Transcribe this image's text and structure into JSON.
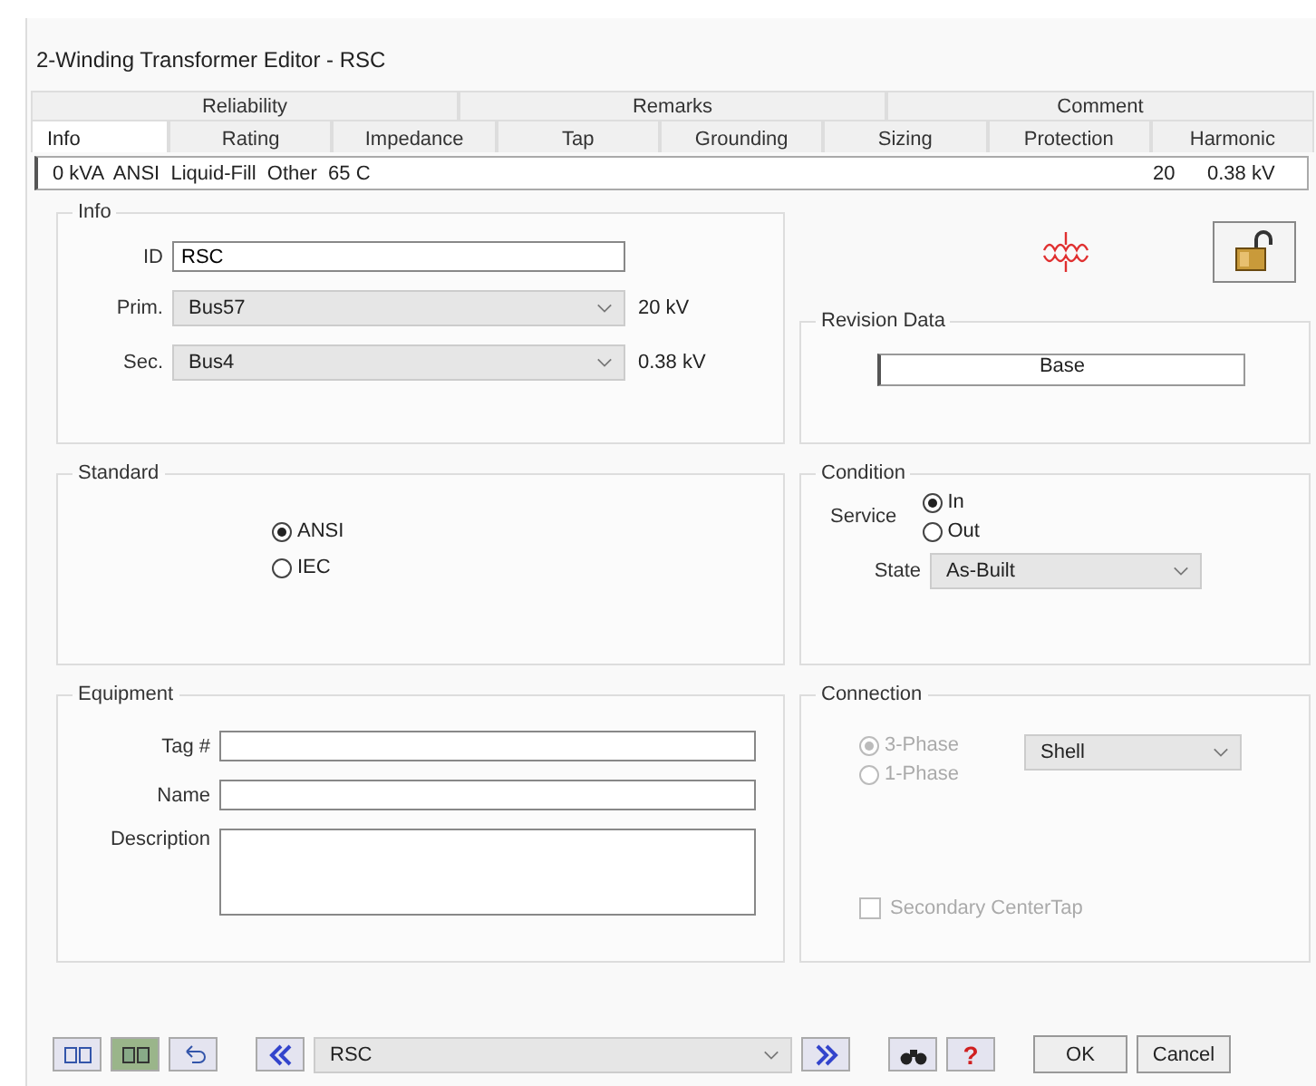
{
  "window": {
    "title": "2-Winding Transformer Editor - RSC"
  },
  "tabs_back": [
    {
      "label": "Reliability",
      "selected": false
    },
    {
      "label": "Remarks",
      "selected": false
    },
    {
      "label": "Comment",
      "selected": false
    }
  ],
  "tabs": [
    {
      "label": "Info",
      "selected": true
    },
    {
      "label": "Rating",
      "selected": false
    },
    {
      "label": "Impedance",
      "selected": false
    },
    {
      "label": "Tap",
      "selected": false
    },
    {
      "label": "Grounding",
      "selected": false
    },
    {
      "label": "Sizing",
      "selected": false
    },
    {
      "label": "Protection",
      "selected": false
    },
    {
      "label": "Harmonic",
      "selected": false
    }
  ],
  "summary": {
    "left": "0 kVA  ANSI  Liquid-Fill  Other  65 C",
    "right_1": "20",
    "right_2": "0.38 kV"
  },
  "info": {
    "title": "Info",
    "id_label": "ID",
    "id_value": "RSC",
    "prim_label": "Prim.",
    "prim_value": "Bus57",
    "prim_kv": "20 kV",
    "sec_label": "Sec.",
    "sec_value": "Bus4",
    "sec_kv": "0.38 kV"
  },
  "revision": {
    "title": "Revision Data",
    "value": "Base"
  },
  "standard": {
    "title": "Standard",
    "options": [
      {
        "label": "ANSI",
        "selected": true
      },
      {
        "label": "IEC",
        "selected": false
      }
    ]
  },
  "condition": {
    "title": "Condition",
    "service_label": "Service",
    "service": [
      {
        "label": "In",
        "selected": true
      },
      {
        "label": "Out",
        "selected": false
      }
    ],
    "state_label": "State",
    "state_value": "As-Built"
  },
  "equipment": {
    "title": "Equipment",
    "tag_label": "Tag #",
    "name_label": "Name",
    "description_label": "Description"
  },
  "connection": {
    "title": "Connection",
    "disabled": true,
    "phases": [
      {
        "label": "3-Phase",
        "selected": true
      },
      {
        "label": "1-Phase",
        "selected": false
      }
    ],
    "type_value": "Shell",
    "center_tap": {
      "label": "Secondary CenterTap",
      "checked": false
    }
  },
  "footer": {
    "nav_value": "RSC",
    "ok": "OK",
    "cancel": "Cancel",
    "help": "?"
  }
}
